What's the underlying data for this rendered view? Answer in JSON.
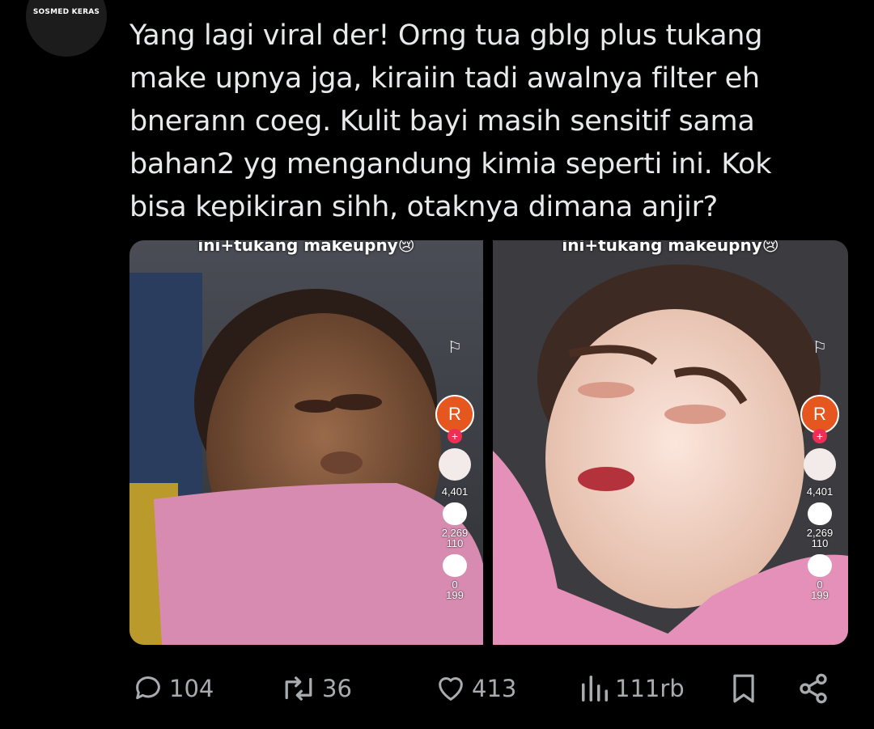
{
  "author": {
    "name": "SOSMED KERAS"
  },
  "tweet": {
    "lines": [
      "Yang lagi viral der! Orng tua gblg plus tukang",
      "make upnya jga, kiraiin tadi awalnya filter eh",
      "bnerann coeg. Kulit bayi masih sensitif sama",
      "bahan2 yg mengandung kimia seperti ini. Kok",
      "bisa kepikiran sihh, otaknya dimana anjir?"
    ]
  },
  "media": {
    "left": {
      "caption": "ini+tukang makeupny😢",
      "creator_initial": "R",
      "likes": "4,401",
      "comments_top": "2,269",
      "comments": "110",
      "saves_top": "0",
      "saves": "199"
    },
    "right": {
      "caption": "ini+tukang makeupny😢",
      "creator_initial": "R",
      "likes": "4,401",
      "comments_top": "2,269",
      "comments": "110",
      "saves_top": "0",
      "saves": "199"
    }
  },
  "actions": {
    "replies": "104",
    "reposts": "36",
    "likes": "413",
    "views": "111rb"
  },
  "colors": {
    "background": "#000000",
    "text": "#e7e9ea",
    "muted": "#a9acaf"
  }
}
